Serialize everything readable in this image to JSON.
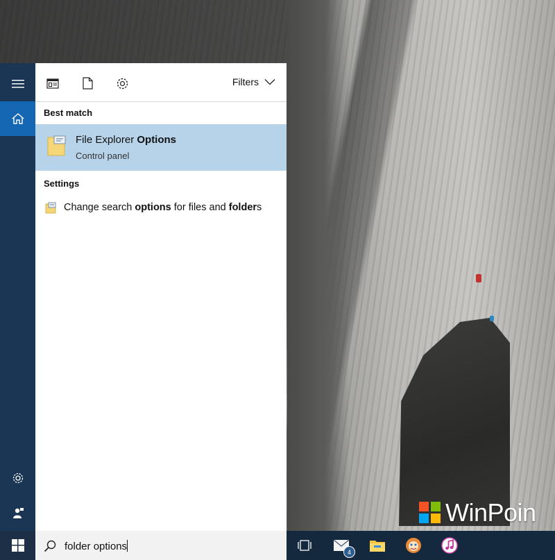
{
  "toolbar": {
    "filters_label": "Filters"
  },
  "sections": {
    "best_match_label": "Best match",
    "settings_label": "Settings"
  },
  "best_match": {
    "title_plain": "File Explorer ",
    "title_bold": "Options",
    "subtitle": "Control panel"
  },
  "settings_result": {
    "part1": "Change search ",
    "part2_bold": "options",
    "part3": " for files and ",
    "part4_bold": "folder",
    "part5": "s"
  },
  "search": {
    "value": "folder options"
  },
  "taskbar": {
    "mail_badge": "4"
  },
  "watermark": {
    "text": "WinPoin"
  },
  "colors": {
    "accent": "#1667b3",
    "rail": "#1b3655",
    "selected_row": "#b7d3ea",
    "taskbar": "#14283e"
  },
  "icons": [
    "hamburger-icon",
    "home-icon",
    "settings-gear-icon",
    "feedback-icon",
    "windows-logo-icon",
    "search-icon",
    "task-view-icon",
    "mail-icon",
    "file-explorer-icon",
    "app-icon",
    "itunes-icon"
  ]
}
